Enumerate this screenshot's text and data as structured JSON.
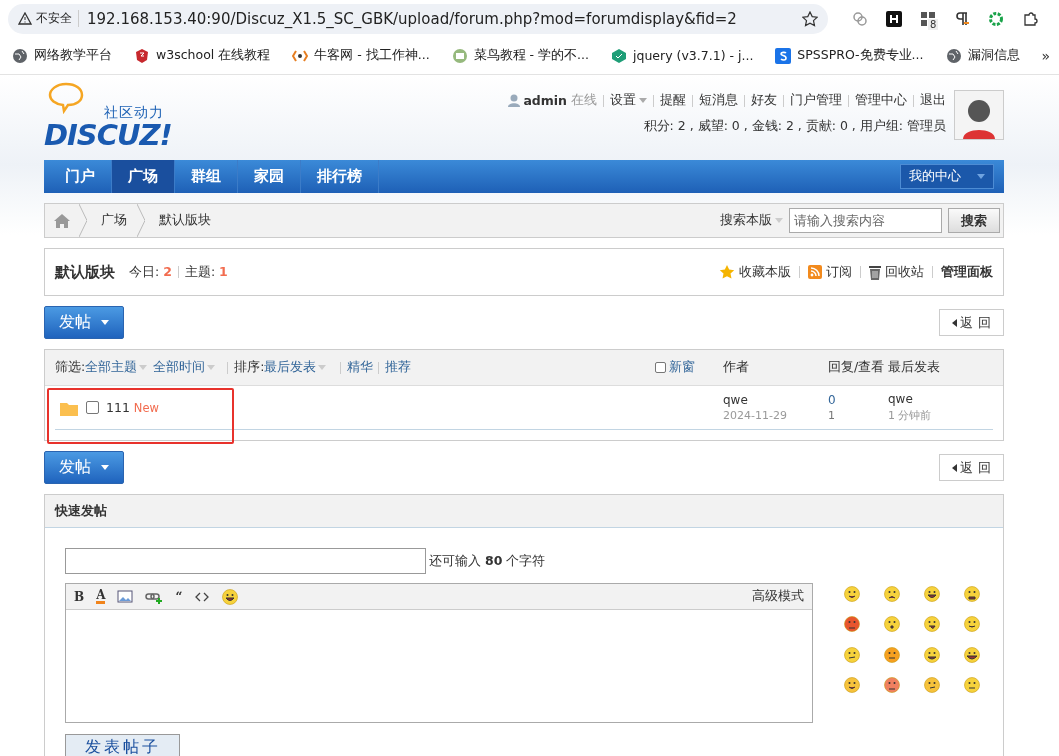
{
  "browser": {
    "security_label": "不安全",
    "url": "192.168.153.40:90/Discuz_X1.5_SC_GBK/upload/forum.php?mod=forumdisplay&fid=2",
    "extension_badge": "8",
    "bookmarks": [
      {
        "kind": "globe",
        "label": "网络教学平台"
      },
      {
        "kind": "shield",
        "label": "w3school 在线教程"
      },
      {
        "kind": "bracket",
        "label": "牛客网 - 找工作神..."
      },
      {
        "kind": "runoob",
        "label": "菜鸟教程 - 学的不..."
      },
      {
        "kind": "cube",
        "label": "jquery (v3.7.1) - j..."
      },
      {
        "kind": "square",
        "label": "SPSSPRO-免费专业..."
      },
      {
        "kind": "globe",
        "label": "漏洞信息"
      }
    ],
    "more": "»"
  },
  "header": {
    "logo_tagline": "社区动力",
    "logo_text": "DISCUZ!",
    "user": {
      "name": "admin",
      "status": "在线"
    },
    "links": [
      {
        "label": "设置",
        "dropdown": true
      },
      {
        "label": "提醒",
        "dropdown": false
      },
      {
        "label": "短消息",
        "dropdown": false
      },
      {
        "label": "好友",
        "dropdown": false
      },
      {
        "label": "门户管理",
        "dropdown": false
      },
      {
        "label": "管理中心",
        "dropdown": false
      },
      {
        "label": "退出",
        "dropdown": false
      }
    ],
    "stats": "积分: 2 , 威望: 0 , 金钱: 2 , 贡献: 0 , 用户组: 管理员"
  },
  "nav": {
    "items": [
      {
        "label": "门户",
        "selected": false
      },
      {
        "label": "广场",
        "selected": true
      },
      {
        "label": "群组",
        "selected": false
      },
      {
        "label": "家园",
        "selected": false
      },
      {
        "label": "排行榜",
        "selected": false
      }
    ],
    "my_center": "我的中心"
  },
  "breadcrumb": {
    "items": [
      "广场",
      "默认版块"
    ],
    "search_scope": "搜索本版",
    "search_placeholder": "请输入搜索内容",
    "search_button": "搜索"
  },
  "forum": {
    "title": "默认版块",
    "stats": [
      {
        "label": "今日:",
        "value": "2"
      },
      {
        "label": "主题:",
        "value": "1"
      }
    ],
    "actions": [
      {
        "kind": "star",
        "label": "收藏本版"
      },
      {
        "kind": "rss",
        "label": "订阅"
      },
      {
        "kind": "trash",
        "label": "回收站"
      },
      {
        "kind": "bold",
        "label": "管理面板"
      }
    ]
  },
  "top_bar": {
    "post_button": "发帖",
    "back_button": "返 回"
  },
  "thread_list": {
    "filter_label": "筛选:",
    "filters": [
      {
        "label": "全部主题",
        "dropdown": true
      },
      {
        "label": "全部时间",
        "dropdown": true
      }
    ],
    "sort_label": "排序:",
    "sort": {
      "label": "最后发表",
      "dropdown": true
    },
    "links": [
      "精华",
      "推荐"
    ],
    "new_window": {
      "label": "新窗",
      "checked": false
    },
    "columns": [
      "作者",
      "回复/查看",
      "最后发表"
    ],
    "threads": [
      {
        "title": "111",
        "badge": "New",
        "checked": false,
        "highlighted": true,
        "author": "qwe",
        "date": "2024-11-29",
        "replies": "0",
        "views": "1",
        "last_poster": "qwe",
        "last_time": "1 分钟前"
      }
    ]
  },
  "bottom_bar": {
    "post_button": "发帖",
    "back_button": "返 回"
  },
  "quick_post": {
    "title": "快速发帖",
    "hint": "还可输入 **80** 个字符",
    "toolbar": [
      {
        "kind": "text",
        "label": "B"
      },
      {
        "kind": "color",
        "label": "A"
      },
      {
        "kind": "image"
      },
      {
        "kind": "link"
      },
      {
        "kind": "text",
        "label": "“"
      },
      {
        "kind": "code"
      },
      {
        "kind": "smiley"
      }
    ],
    "advanced": "高级模式",
    "submit": "发表帖子",
    "emoticons": [
      {
        "kind": "smile"
      },
      {
        "kind": "sad"
      },
      {
        "kind": "grin"
      },
      {
        "kind": "cry"
      },
      {
        "kind": "angry"
      },
      {
        "kind": "surprised"
      },
      {
        "kind": "tongue"
      },
      {
        "kind": "shy"
      },
      {
        "kind": "think"
      },
      {
        "kind": "wink"
      },
      {
        "kind": "mad"
      },
      {
        "kind": "laugh"
      },
      {
        "kind": "blush"
      },
      {
        "kind": "upset"
      },
      {
        "kind": "smirk"
      },
      {
        "kind": "sweat"
      }
    ]
  }
}
